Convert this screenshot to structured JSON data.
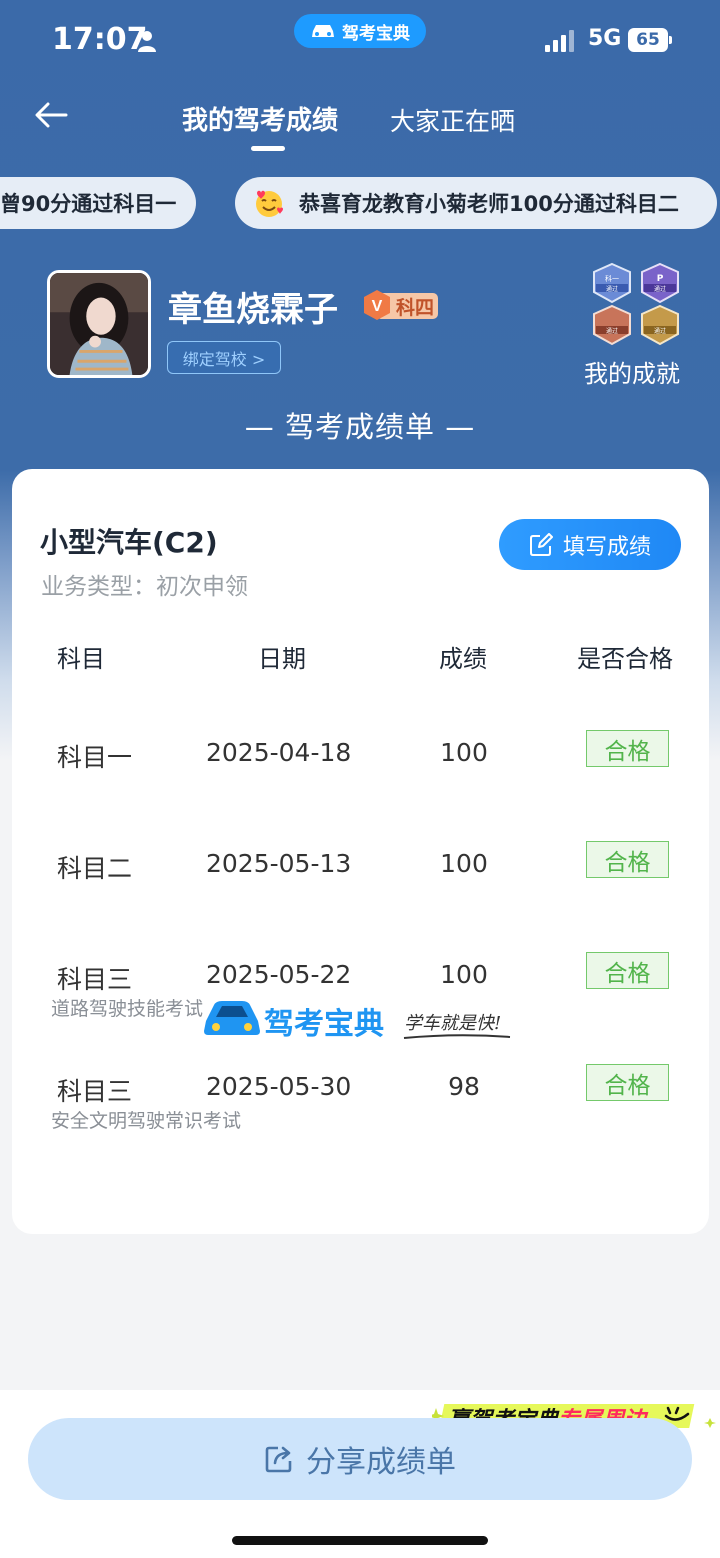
{
  "status_bar": {
    "time": "17:07",
    "network": "5G",
    "battery": "65",
    "app_name": "驾考宝典"
  },
  "nav": {
    "tabs": [
      {
        "label": "我的驾考成绩",
        "active": true
      },
      {
        "label": "大家正在晒",
        "active": false
      }
    ]
  },
  "ticker": {
    "items": [
      "曾90分通过科目一",
      "恭喜育龙教育小菊老师100分通过科目二"
    ]
  },
  "profile": {
    "username": "章鱼烧霖子",
    "level_badge": "科四",
    "bind_school": "绑定驾校 >",
    "achievements_label": "我的成就",
    "achievement_badges": [
      "通过",
      "通过",
      "通过",
      "通过"
    ],
    "achievement_badge_tags": [
      "科一",
      "P"
    ]
  },
  "sheet": {
    "title": "— 驾考成绩单 —",
    "vehicle": "小型汽车(C2)",
    "business_type": "业务类型：初次申领",
    "fill_button": "填写成绩",
    "headers": [
      "科目",
      "日期",
      "成绩",
      "是否合格"
    ],
    "rows": [
      {
        "subject": "科目一",
        "date": "2025-04-18",
        "score": "100",
        "result": "合格",
        "note": ""
      },
      {
        "subject": "科目二",
        "date": "2025-05-13",
        "score": "100",
        "result": "合格",
        "note": ""
      },
      {
        "subject": "科目三",
        "date": "2025-05-22",
        "score": "100",
        "result": "合格",
        "note": "道路驾驶技能考试"
      },
      {
        "subject": "科目三",
        "date": "2025-05-30",
        "score": "98",
        "result": "合格",
        "note": "安全文明驾驶常识考试"
      }
    ],
    "brand": "驾考宝典",
    "slogan": "学车就是快!"
  },
  "promo": {
    "text_prefix": "赢驾考宝典",
    "text_highlight": "专属周边"
  },
  "share_button": "分享成绩单",
  "colors": {
    "header_blue": "#3b6aa9",
    "accent_blue": "#1f88f5",
    "pass_green": "#52b44b",
    "share_bg": "#cde4fb"
  }
}
